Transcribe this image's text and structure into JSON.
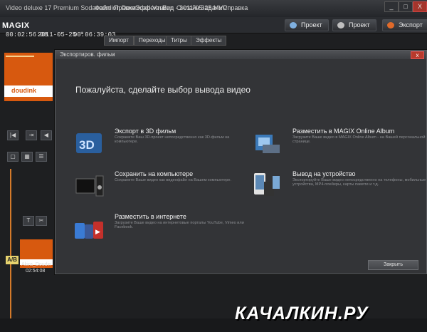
{
  "window": {
    "title": "Video deluxe 17 Premium Sodaccordion Download-Version - 2011-05-25 MVP",
    "menu": [
      "Файл",
      "Правка",
      "Эффекты",
      "Вид",
      "Онлайн",
      "Задачи",
      "Справка"
    ],
    "controls": {
      "minimize": "_",
      "maximize": "□",
      "close": "X"
    }
  },
  "toolbar": {
    "logo": "MAGIX",
    "timecode_left": "00:02:56:08",
    "date": "2011-05-25 *",
    "timecode_right": "00:06:39:03",
    "brand_button": "Проект",
    "photo_button": "Проект",
    "export_button": "Экспорт"
  },
  "background_tabs": [
    "Импорт",
    "Переходы",
    "Титры",
    "Эффекты"
  ],
  "preview": {
    "caption": "doudink"
  },
  "dialog": {
    "title": "Экспортиров. фильм",
    "close_symbol": "x",
    "heading": "Пожалуйста, сделайте выбор вывода видео",
    "options": [
      {
        "label": "Экспорт в 3D фильм",
        "desc": "Сохраните Ваш 3D-проект непосредственно как 3D-фильм на компьютере.",
        "icon": "3d-icon"
      },
      {
        "label": "Разместить в MAGIX Online Album",
        "desc": "Загрузите Ваше видео в MAGIX Online Album - на Вашей персональной странице.",
        "icon": "online-album-icon"
      },
      {
        "label": "Сохранить на компьютере",
        "desc": "Сохраните Ваше видео как видеофайл на Вашем компьютере.",
        "icon": "computer-icon"
      },
      {
        "label": "Вывод на устройство",
        "desc": "Экспортируйте Ваше видео непосредственно на телефоны, мобильные устройства, MP4-плейеры, карты памяти и т.д.",
        "icon": "device-icon"
      },
      {
        "label": "Разместить в интернете",
        "desc": "Загрузите Ваше видео на интернетовые порталы YouTube, Vimeo или Facebook.",
        "icon": "internet-icon"
      }
    ],
    "close_button": "Закрыть"
  },
  "timeline": {
    "ab_badge": "A/B",
    "clip_name": "Akira_Doudin",
    "clip_time": "02:54:08"
  },
  "watermark": "КАЧАЛКИН.РУ"
}
